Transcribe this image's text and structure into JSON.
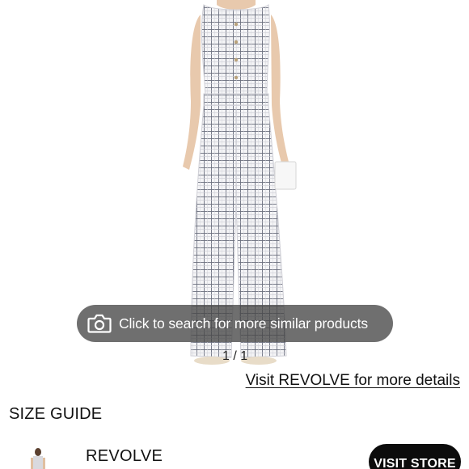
{
  "image_search": {
    "label": "Click to search for more similar products",
    "icon": "camera-icon"
  },
  "product": {
    "image_counter": "1 / 1",
    "image_description_icon": "product-photo"
  },
  "links": {
    "visit_details": "Visit REVOLVE for more details"
  },
  "sections": {
    "size_guide": "SIZE GUIDE"
  },
  "store": {
    "name": "REVOLVE",
    "button_label": "VISIT STORE"
  },
  "colors": {
    "pill_background": "#464646",
    "button_background": "#0c0c0c",
    "text": "#111111"
  }
}
